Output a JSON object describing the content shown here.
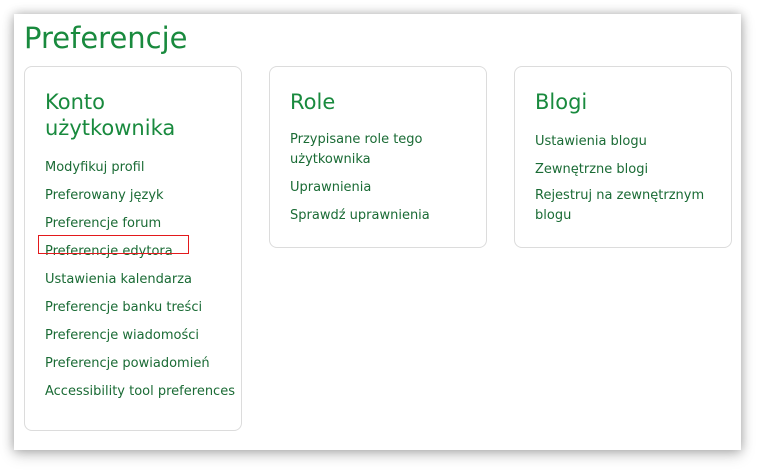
{
  "page": {
    "title": "Preferencje"
  },
  "sections": [
    {
      "heading": "Konto użytkownika",
      "links": [
        "Modyfikuj profil",
        "Preferowany język",
        "Preferencje forum",
        "Preferencje edytora",
        "Ustawienia kalendarza",
        "Preferencje banku treści",
        "Preferencje wiadomości",
        "Preferencje powiadomień",
        "Accessibility tool preferences"
      ]
    },
    {
      "heading": "Role",
      "links": [
        "Przypisane role tego użytkownika",
        "Uprawnienia",
        "Sprawdź uprawnienia"
      ]
    },
    {
      "heading": "Blogi",
      "links": [
        "Ustawienia blogu",
        "Zewnętrzne blogi",
        "Rejestruj na zewnętrznym blogu"
      ]
    }
  ],
  "colors": {
    "heading_green": "#198a3e",
    "link_green": "#1a6b35",
    "highlight_red": "#e3191c",
    "card_border": "#dcdcdc"
  }
}
